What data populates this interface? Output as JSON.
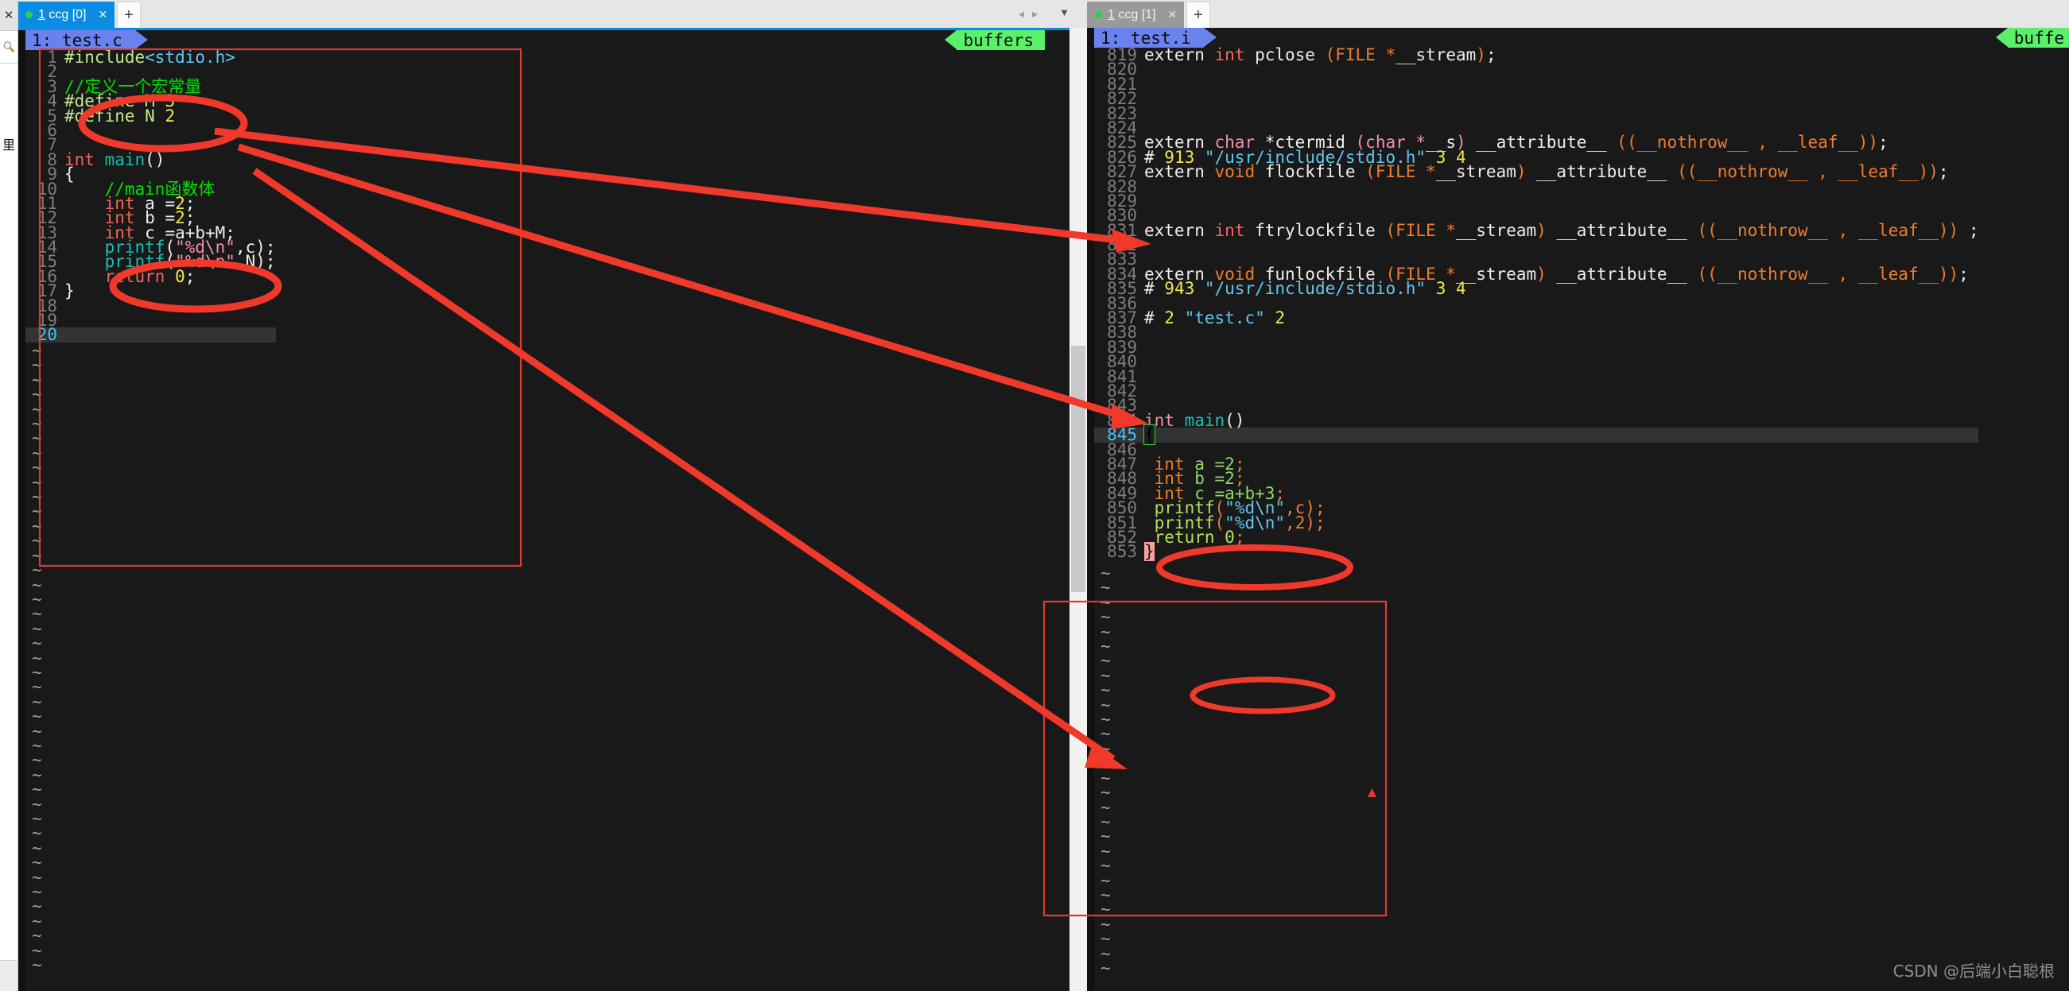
{
  "rail": {
    "close_label": "✕",
    "search_icon": "search-icon",
    "cn_label": "里"
  },
  "tabs": {
    "left": {
      "label_prefix": "1",
      "label_rest": " ccg [0]",
      "close": "✕",
      "new": "+"
    },
    "right": {
      "label_prefix": "1",
      "label_rest": " ccg [1]",
      "close": "✕",
      "new": "+"
    },
    "nav_prev": "◂",
    "nav_next": "▸",
    "nav_caret": "▼"
  },
  "left_pane": {
    "file_tag": "1: test.c",
    "buffers_tag": "buffers",
    "lines": [
      {
        "n": "1",
        "parts": [
          {
            "t": "#include",
            "c": "pp"
          },
          {
            "t": "<stdio.h>",
            "c": "str2"
          }
        ]
      },
      {
        "n": "2",
        "parts": []
      },
      {
        "n": "3",
        "parts": [
          {
            "t": "//定义一个宏常量",
            "c": "cm"
          }
        ]
      },
      {
        "n": "4",
        "parts": [
          {
            "t": "#define M ",
            "c": "pp"
          },
          {
            "t": "3",
            "c": "num"
          }
        ]
      },
      {
        "n": "5",
        "parts": [
          {
            "t": "#define N ",
            "c": "pp"
          },
          {
            "t": "2",
            "c": "num"
          }
        ]
      },
      {
        "n": "6",
        "parts": []
      },
      {
        "n": "7",
        "parts": []
      },
      {
        "n": "8",
        "parts": [
          {
            "t": "int ",
            "c": "kw"
          },
          {
            "t": "main",
            "c": "fn"
          },
          {
            "t": "()",
            "c": "wht"
          }
        ]
      },
      {
        "n": "9",
        "parts": [
          {
            "t": "{",
            "c": "wht"
          }
        ]
      },
      {
        "n": "10",
        "parts": [
          {
            "t": "    //main函数体",
            "c": "cm"
          }
        ]
      },
      {
        "n": "11",
        "parts": [
          {
            "t": "    ",
            "c": "wht"
          },
          {
            "t": "int ",
            "c": "kw"
          },
          {
            "t": "a =",
            "c": "wht"
          },
          {
            "t": "2",
            "c": "num"
          },
          {
            "t": ";",
            "c": "wht"
          }
        ]
      },
      {
        "n": "12",
        "parts": [
          {
            "t": "    ",
            "c": "wht"
          },
          {
            "t": "int ",
            "c": "kw"
          },
          {
            "t": "b =",
            "c": "wht"
          },
          {
            "t": "2",
            "c": "num"
          },
          {
            "t": ";",
            "c": "wht"
          }
        ]
      },
      {
        "n": "13",
        "parts": [
          {
            "t": "    ",
            "c": "wht"
          },
          {
            "t": "int ",
            "c": "kw"
          },
          {
            "t": "c =a+b+M;",
            "c": "wht"
          }
        ]
      },
      {
        "n": "14",
        "parts": [
          {
            "t": "    ",
            "c": "wht"
          },
          {
            "t": "printf",
            "c": "fn"
          },
          {
            "t": "(",
            "c": "wht"
          },
          {
            "t": "\"%d\\n\"",
            "c": "str"
          },
          {
            "t": ",c);",
            "c": "wht"
          }
        ]
      },
      {
        "n": "15",
        "parts": [
          {
            "t": "    ",
            "c": "wht"
          },
          {
            "t": "printf",
            "c": "fn"
          },
          {
            "t": "(",
            "c": "wht"
          },
          {
            "t": "\"%d\\n\"",
            "c": "str"
          },
          {
            "t": ",N);",
            "c": "wht"
          }
        ]
      },
      {
        "n": "16",
        "parts": [
          {
            "t": "    ",
            "c": "wht"
          },
          {
            "t": "return ",
            "c": "kw"
          },
          {
            "t": "0",
            "c": "num"
          },
          {
            "t": ";",
            "c": "wht"
          }
        ]
      },
      {
        "n": "17",
        "parts": [
          {
            "t": "}",
            "c": "wht"
          }
        ]
      },
      {
        "n": "18",
        "parts": []
      },
      {
        "n": "19",
        "parts": []
      },
      {
        "n": "20",
        "parts": [],
        "current": true
      }
    ]
  },
  "right_pane": {
    "file_tag": "1: test.i",
    "buffers_tag": "buffe",
    "lines": [
      {
        "n": "819",
        "parts": [
          {
            "t": "extern ",
            "c": "wht"
          },
          {
            "t": "int ",
            "c": "kw"
          },
          {
            "t": "pclose ",
            "c": "wht"
          },
          {
            "t": "(FILE *",
            "c": "org"
          },
          {
            "t": "__stream",
            "c": "wht"
          },
          {
            "t": ")",
            "c": "org"
          },
          {
            "t": ";",
            "c": "wht"
          }
        ]
      },
      {
        "n": "820",
        "parts": []
      },
      {
        "n": "821",
        "parts": []
      },
      {
        "n": "822",
        "parts": []
      },
      {
        "n": "823",
        "parts": []
      },
      {
        "n": "824",
        "parts": []
      },
      {
        "n": "825",
        "parts": [
          {
            "t": "extern ",
            "c": "wht"
          },
          {
            "t": "char ",
            "c": "str"
          },
          {
            "t": "*ctermid ",
            "c": "wht"
          },
          {
            "t": "(char *",
            "c": "str"
          },
          {
            "t": "__s",
            "c": "wht"
          },
          {
            "t": ")",
            "c": "str"
          },
          {
            "t": " __attribute__ ",
            "c": "wht"
          },
          {
            "t": "((__nothrow__ , __leaf__))",
            "c": "org"
          },
          {
            "t": ";",
            "c": "wht"
          }
        ]
      },
      {
        "n": "826",
        "parts": [
          {
            "t": "# ",
            "c": "wht"
          },
          {
            "t": "913 ",
            "c": "num"
          },
          {
            "t": "\"/usr/include/stdio.h\"",
            "c": "str2"
          },
          {
            "t": " ",
            "c": "wht"
          },
          {
            "t": "3 4",
            "c": "num"
          }
        ]
      },
      {
        "n": "827",
        "parts": [
          {
            "t": "extern ",
            "c": "wht"
          },
          {
            "t": "void ",
            "c": "org"
          },
          {
            "t": "flockfile ",
            "c": "wht"
          },
          {
            "t": "(FILE *",
            "c": "org"
          },
          {
            "t": "__stream",
            "c": "wht"
          },
          {
            "t": ")",
            "c": "org"
          },
          {
            "t": " __attribute__ ",
            "c": "wht"
          },
          {
            "t": "((__nothrow__ , __leaf__))",
            "c": "org"
          },
          {
            "t": ";",
            "c": "wht"
          }
        ]
      },
      {
        "n": "828",
        "parts": []
      },
      {
        "n": "829",
        "parts": []
      },
      {
        "n": "830",
        "parts": []
      },
      {
        "n": "831",
        "parts": [
          {
            "t": "extern ",
            "c": "wht"
          },
          {
            "t": "int ",
            "c": "kw"
          },
          {
            "t": "ftrylockfile ",
            "c": "wht"
          },
          {
            "t": "(FILE *",
            "c": "org"
          },
          {
            "t": "__stream",
            "c": "wht"
          },
          {
            "t": ")",
            "c": "org"
          },
          {
            "t": " __attribute__ ",
            "c": "wht"
          },
          {
            "t": "((__nothrow__ , __leaf__))",
            "c": "org"
          },
          {
            "t": " ;",
            "c": "wht"
          }
        ]
      },
      {
        "n": "832",
        "parts": []
      },
      {
        "n": "833",
        "parts": []
      },
      {
        "n": "834",
        "parts": [
          {
            "t": "extern ",
            "c": "wht"
          },
          {
            "t": "void ",
            "c": "org"
          },
          {
            "t": "funlockfile ",
            "c": "wht"
          },
          {
            "t": "(FILE *",
            "c": "org"
          },
          {
            "t": "__stream",
            "c": "wht"
          },
          {
            "t": ")",
            "c": "org"
          },
          {
            "t": " __attribute__ ",
            "c": "wht"
          },
          {
            "t": "((__nothrow__ , __leaf__))",
            "c": "org"
          },
          {
            "t": ";",
            "c": "wht"
          }
        ]
      },
      {
        "n": "835",
        "parts": [
          {
            "t": "# ",
            "c": "wht"
          },
          {
            "t": "943 ",
            "c": "num"
          },
          {
            "t": "\"/usr/include/stdio.h\"",
            "c": "str2"
          },
          {
            "t": " ",
            "c": "wht"
          },
          {
            "t": "3 4",
            "c": "num"
          }
        ]
      },
      {
        "n": "836",
        "parts": []
      },
      {
        "n": "837",
        "parts": [
          {
            "t": "# ",
            "c": "wht"
          },
          {
            "t": "2 ",
            "c": "num"
          },
          {
            "t": "\"test.c\"",
            "c": "str2"
          },
          {
            "t": " ",
            "c": "wht"
          },
          {
            "t": "2",
            "c": "num"
          }
        ]
      },
      {
        "n": "838",
        "parts": []
      },
      {
        "n": "839",
        "parts": []
      },
      {
        "n": "840",
        "parts": []
      },
      {
        "n": "841",
        "parts": []
      },
      {
        "n": "842",
        "parts": []
      },
      {
        "n": "843",
        "parts": []
      },
      {
        "n": "844",
        "parts": [
          {
            "t": "int ",
            "c": "str"
          },
          {
            "t": "main",
            "c": "fn"
          },
          {
            "t": "()",
            "c": "wht"
          }
        ]
      },
      {
        "n": "845",
        "parts": [
          {
            "t": "{",
            "c": "cursor"
          }
        ],
        "current": true
      },
      {
        "n": "846",
        "parts": []
      },
      {
        "n": "847",
        "parts": [
          {
            "t": " ",
            "c": "wht"
          },
          {
            "t": "int ",
            "c": "kw2"
          },
          {
            "t": "a =",
            "c": "grn"
          },
          {
            "t": "2",
            "c": "grn"
          },
          {
            "t": ";",
            "c": "org"
          }
        ]
      },
      {
        "n": "848",
        "parts": [
          {
            "t": " ",
            "c": "wht"
          },
          {
            "t": "int ",
            "c": "kw2"
          },
          {
            "t": "b =",
            "c": "grn"
          },
          {
            "t": "2",
            "c": "grn"
          },
          {
            "t": ";",
            "c": "org"
          }
        ]
      },
      {
        "n": "849",
        "parts": [
          {
            "t": " ",
            "c": "wht"
          },
          {
            "t": "int ",
            "c": "kw2"
          },
          {
            "t": "c =a+b+",
            "c": "grn"
          },
          {
            "t": "3",
            "c": "grn"
          },
          {
            "t": ";",
            "c": "org"
          }
        ]
      },
      {
        "n": "850",
        "parts": [
          {
            "t": " ",
            "c": "wht"
          },
          {
            "t": "printf",
            "c": "fn2"
          },
          {
            "t": "(",
            "c": "org"
          },
          {
            "t": "\"%d\\n\"",
            "c": "str2"
          },
          {
            "t": ",c)",
            "c": "org"
          },
          {
            "t": ";",
            "c": "org"
          }
        ]
      },
      {
        "n": "851",
        "parts": [
          {
            "t": " ",
            "c": "wht"
          },
          {
            "t": "printf",
            "c": "fn2"
          },
          {
            "t": "(",
            "c": "org"
          },
          {
            "t": "\"%d\\n\"",
            "c": "str2"
          },
          {
            "t": ",",
            "c": "org"
          },
          {
            "t": "2",
            "c": "org"
          },
          {
            "t": ")",
            "c": "org"
          },
          {
            "t": ";",
            "c": "org"
          }
        ]
      },
      {
        "n": "852",
        "parts": [
          {
            "t": " ",
            "c": "wht"
          },
          {
            "t": "return ",
            "c": "fn2"
          },
          {
            "t": "0",
            "c": "fn2"
          },
          {
            "t": ";",
            "c": "org"
          }
        ]
      },
      {
        "n": "853",
        "parts": [
          {
            "t": "}",
            "c": "curbrace"
          }
        ]
      }
    ]
  },
  "annotations": {
    "accent_color": "#f0392b",
    "ellipse_labels": [
      "macro-comment-ellipse",
      "main-body-comment-ellipse",
      "blank-line-840-ellipse",
      "blank-line-846-ellipse"
    ],
    "box_labels": [
      "source-box",
      "expanded-box"
    ],
    "arrow_labels": [
      "arrow-to-line-826",
      "arrow-to-line-834",
      "arrow-to-line-849"
    ]
  },
  "watermark": "CSDN @后端小白聪根"
}
